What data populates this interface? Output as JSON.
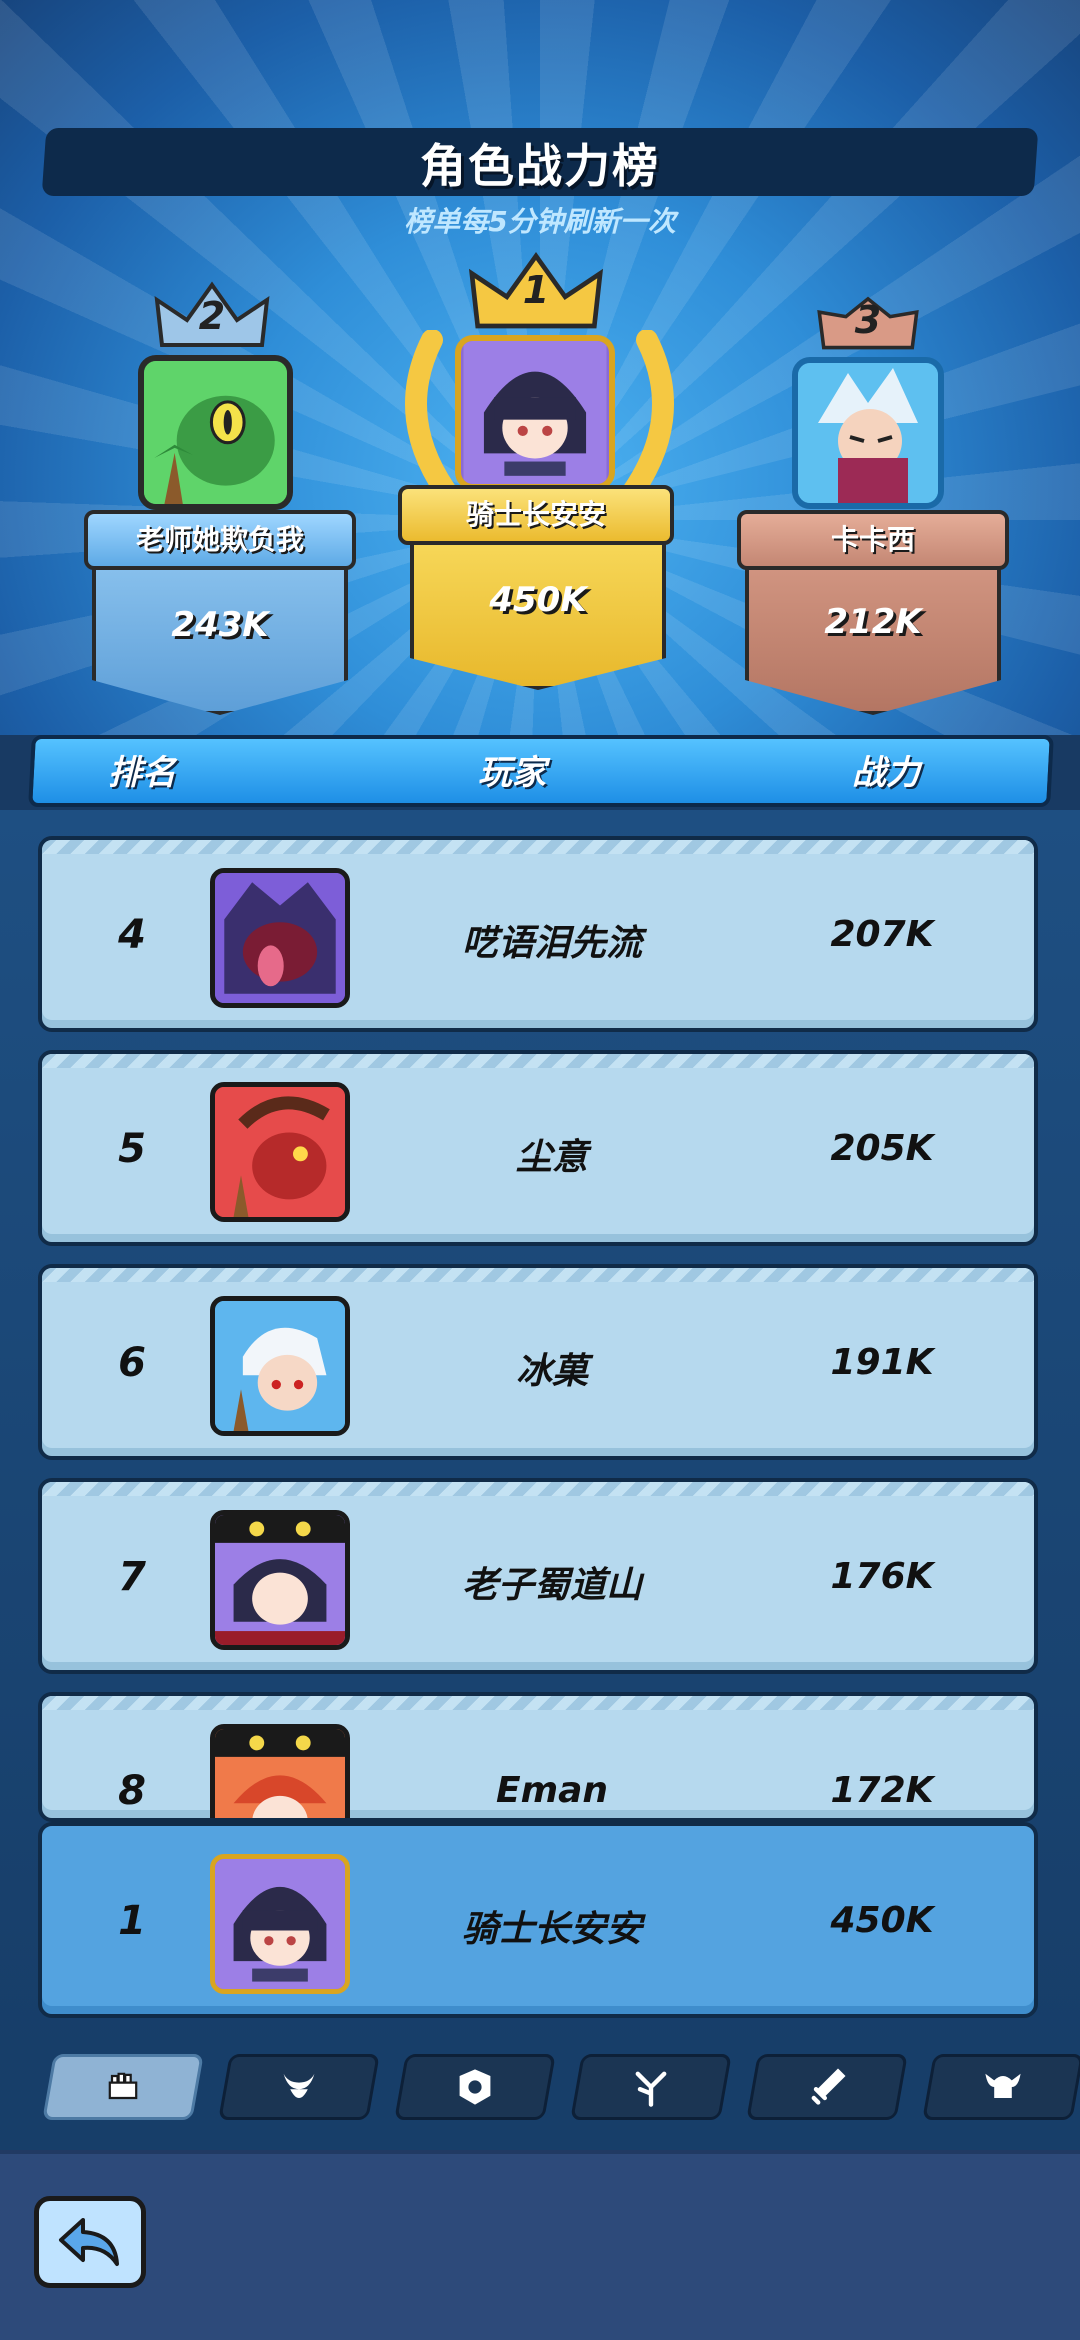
{
  "header": {
    "title": "角色战力榜",
    "subtitle": "榜单每5分钟刷新一次"
  },
  "podium": [
    {
      "place": "2",
      "name": "老师她欺负我",
      "score": "243K"
    },
    {
      "place": "1",
      "name": "骑士长安安",
      "score": "450K"
    },
    {
      "place": "3",
      "name": "卡卡西",
      "score": "212K"
    }
  ],
  "columns": {
    "rank": "排名",
    "player": "玩家",
    "power": "战力"
  },
  "rows": [
    {
      "rank": "4",
      "name": "呓语泪先流",
      "power": "207K"
    },
    {
      "rank": "5",
      "name": "尘意",
      "power": "205K"
    },
    {
      "rank": "6",
      "name": "冰菓",
      "power": "191K"
    },
    {
      "rank": "7",
      "name": "老子蜀道山",
      "power": "176K"
    },
    {
      "rank": "8",
      "name": "Eman",
      "power": "172K"
    }
  ],
  "self_row": {
    "rank": "1",
    "name": "骑士长安安",
    "power": "450K"
  },
  "tabs": [
    {
      "icon": "fist-icon",
      "active": true
    },
    {
      "icon": "horned-helmet-icon",
      "active": false
    },
    {
      "icon": "shield-emblem-icon",
      "active": false
    },
    {
      "icon": "branch-icon",
      "active": false
    },
    {
      "icon": "sword-icon",
      "active": false
    },
    {
      "icon": "viking-helmet-icon",
      "active": false
    }
  ],
  "back_icon": "back-arrow-icon",
  "colors": {
    "gold": "#f5c842",
    "silver_blue": "#7ab8ea",
    "bronze": "#c98a76",
    "row_bg": "#b6d9ee",
    "self_row_bg": "#54a3e0"
  }
}
